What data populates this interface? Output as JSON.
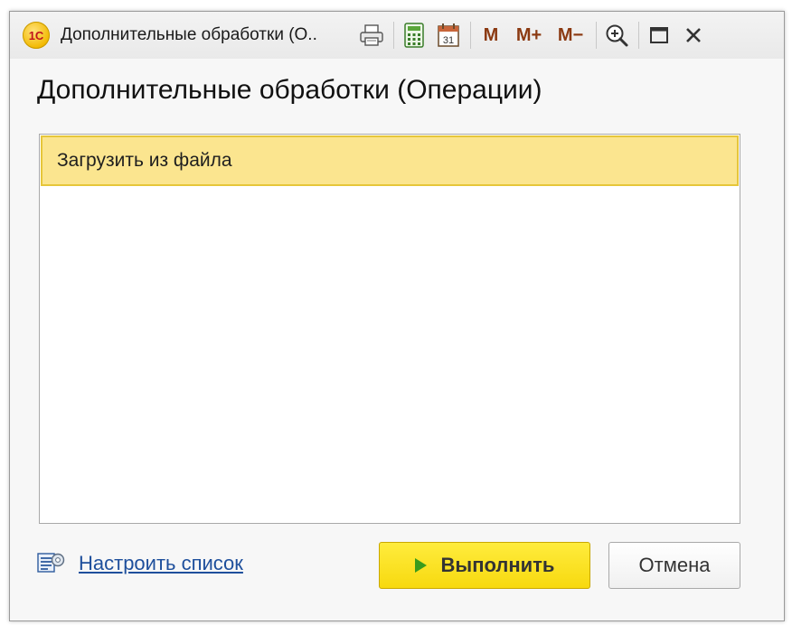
{
  "window": {
    "title": "Дополнительные обработки (О..",
    "logo_text": "1С",
    "toolbar": {
      "m_label": "M",
      "mplus_label": "M+",
      "mminus_label": "M−",
      "calendar_day": "31"
    }
  },
  "form": {
    "heading": "Дополнительные обработки (Операции)",
    "list": {
      "items": [
        {
          "label": "Загрузить из файла",
          "selected": true
        }
      ]
    },
    "settings_link": "Настроить список",
    "execute_button": "Выполнить",
    "cancel_button": "Отмена"
  },
  "colors": {
    "selected_row": "#fbe58f",
    "primary_button": "#f7d90f",
    "link": "#1e4f9c"
  }
}
